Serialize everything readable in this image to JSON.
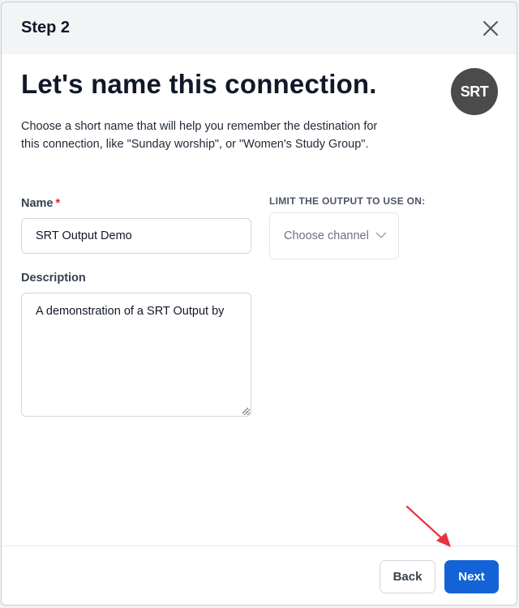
{
  "header": {
    "step_title": "Step 2"
  },
  "main": {
    "title": "Let's name this connection.",
    "intro": "Choose a short name that will help you remember the destination for this connection, like \"Sunday worship\", or \"Women's Study Group\".",
    "logo_text": "SRT",
    "name_field": {
      "label": "Name",
      "required_mark": "*",
      "value": "SRT Output Demo"
    },
    "description_field": {
      "label": "Description",
      "value": "A demonstration of a SRT Output by"
    },
    "channel": {
      "label": "LIMIT THE OUTPUT TO USE ON:",
      "placeholder": "Choose channel"
    }
  },
  "footer": {
    "back_label": "Back",
    "next_label": "Next"
  },
  "colors": {
    "primary": "#1363d6",
    "required": "#dc2626",
    "annotation_arrow": "#e8323c"
  },
  "icons": {
    "close": "close-icon",
    "chevron": "chevron-down-icon",
    "logo": "srt-logo"
  }
}
